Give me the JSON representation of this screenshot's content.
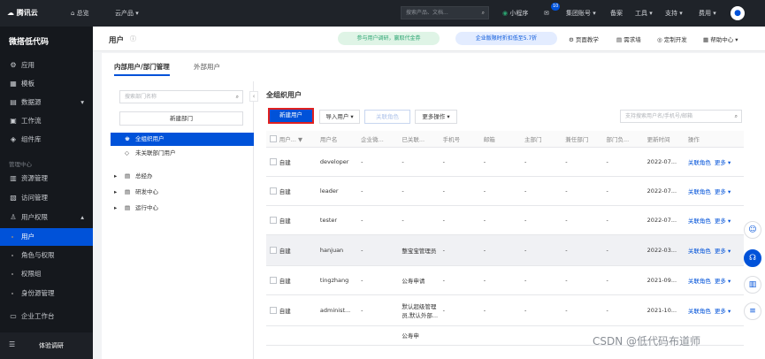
{
  "topbar": {
    "logo": "腾讯云",
    "home": "总览",
    "products": "云产品",
    "search_placeholder": "搜索产品、文档...",
    "miniprogram": "小程序",
    "mail_badge": "10",
    "account": "集团账号",
    "filing": "备案",
    "tools": "工具",
    "support": "支持",
    "expense": "费用"
  },
  "sidebar": {
    "title": "微搭低代码",
    "items": [
      {
        "icon": "⚙",
        "label": "应用"
      },
      {
        "icon": "▦",
        "label": "模板"
      },
      {
        "icon": "▤",
        "label": "数据源"
      },
      {
        "icon": "▣",
        "label": "工作流"
      },
      {
        "icon": "◈",
        "label": "组件库"
      }
    ],
    "section": "管理中心",
    "admin_items": [
      {
        "icon": "▥",
        "label": "资源管理"
      },
      {
        "icon": "▧",
        "label": "访问管理"
      },
      {
        "icon": "♙",
        "label": "用户权限"
      }
    ],
    "sub_items": [
      "用户",
      "角色与权限",
      "权限组",
      "身份源管理"
    ],
    "bottom_item": "企业工作台",
    "footer": "体验调研"
  },
  "header": {
    "title": "用户",
    "banner1": "参与用户调研，赢取代金券",
    "banner2": "企业版限时折扣低至5.7折",
    "guide": "页面教学",
    "feedback": "需求墙",
    "custom": "定制开发",
    "help": "帮助中心"
  },
  "tabs": [
    "内部用户/部门管理",
    "外部用户"
  ],
  "leftpane": {
    "search_placeholder": "搜索部门名称",
    "new_dept": "新建部门",
    "tree": [
      "全组织用户",
      "未关联部门用户",
      "总经办",
      "研发中心",
      "运行中心"
    ]
  },
  "rightpane": {
    "title": "全组织用户",
    "new_user": "新建用户",
    "import": "导入用户",
    "assoc_role": "关联角色",
    "more": "更多操作",
    "search_placeholder": "支持搜索用户名/手机号/邮箱",
    "columns": [
      "用户...",
      "用户名",
      "企业微...",
      "已关联...",
      "手机号",
      "邮箱",
      "主部门",
      "兼任部门",
      "部门负...",
      "更新时间",
      "操作"
    ],
    "rows": [
      {
        "source": "自建",
        "name": "developer",
        "wx": "-",
        "role": "-",
        "phone": "-",
        "mail": "-",
        "dept": "-",
        "side": "-",
        "lead": "-",
        "time": "2022-07..."
      },
      {
        "source": "自建",
        "name": "leader",
        "wx": "-",
        "role": "-",
        "phone": "-",
        "mail": "-",
        "dept": "-",
        "side": "-",
        "lead": "-",
        "time": "2022-07..."
      },
      {
        "source": "自建",
        "name": "tester",
        "wx": "-",
        "role": "-",
        "phone": "-",
        "mail": "-",
        "dept": "-",
        "side": "-",
        "lead": "-",
        "time": "2022-07..."
      },
      {
        "source": "自建",
        "name": "hanjuan",
        "wx": "-",
        "role": "整宝宝管理员",
        "phone": "-",
        "mail": "-",
        "dept": "-",
        "side": "-",
        "lead": "-",
        "time": "2022-03..."
      },
      {
        "source": "自建",
        "name": "tingzhang",
        "wx": "-",
        "role": "公寿申请",
        "phone": "-",
        "mail": "-",
        "dept": "-",
        "side": "-",
        "lead": "-",
        "time": "2021-09..."
      },
      {
        "source": "自建",
        "name": "administ...",
        "wx": "-",
        "role": "默认超级管理员,默认外部...",
        "phone": "-",
        "mail": "-",
        "dept": "-",
        "side": "-",
        "lead": "-",
        "time": "2021-10..."
      },
      {
        "source": "",
        "name": "",
        "wx": "",
        "role": "公寿申",
        "phone": "",
        "mail": "",
        "dept": "",
        "side": "",
        "lead": "",
        "time": ""
      }
    ],
    "op_role": "关联角色",
    "op_more": "更多"
  },
  "watermark": "CSDN @低代码布道师"
}
